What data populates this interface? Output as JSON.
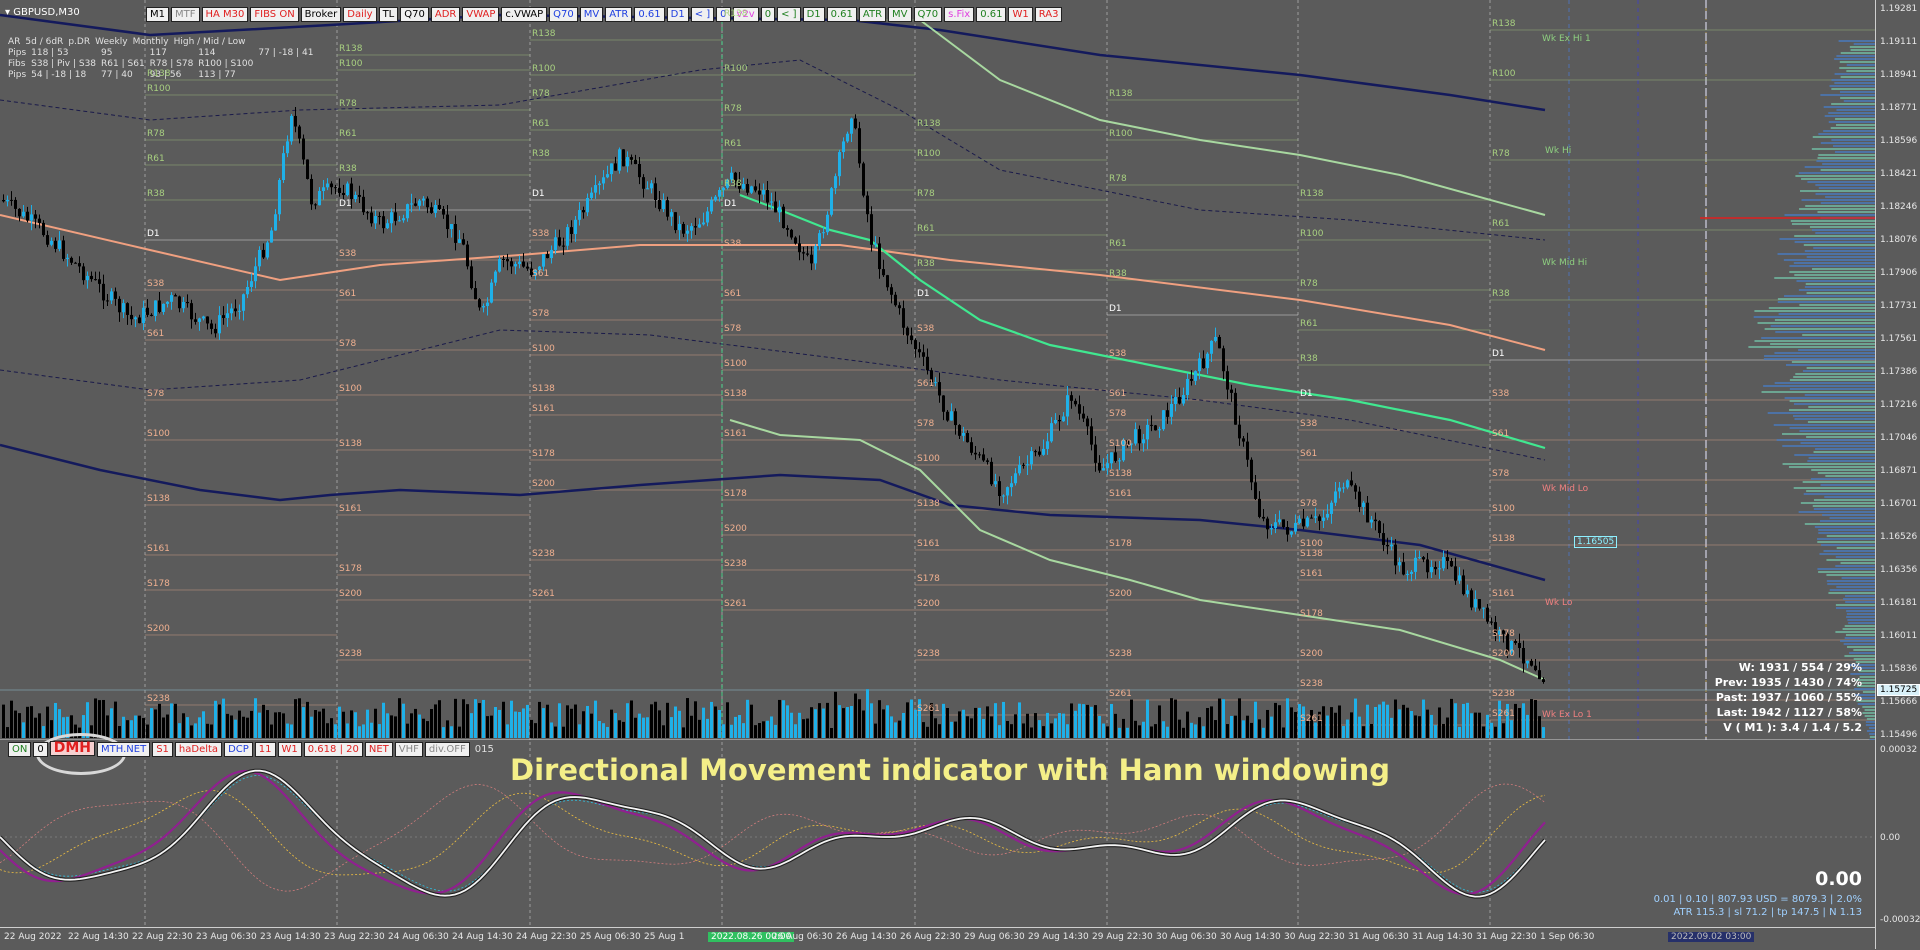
{
  "symbol": "GBPUSD,M30",
  "toolbar_top": [
    {
      "label": "M1",
      "color": "#000000",
      "bg": "#f0f0f0"
    },
    {
      "label": "MTF",
      "color": "#888888",
      "bg": "#f0f0f0"
    },
    {
      "label": "HA M30",
      "color": "#e02020",
      "bg": "#f0f0f0"
    },
    {
      "label": "FIBS ON",
      "color": "#e02020",
      "bg": "#f0f0f0"
    },
    {
      "label": "Broker",
      "color": "#000000",
      "bg": "#f0f0f0"
    },
    {
      "label": "Daily",
      "color": "#e02020",
      "bg": "#f0f0f0"
    },
    {
      "label": "TL",
      "color": "#000000",
      "bg": "#f0f0f0"
    },
    {
      "label": "Q70",
      "color": "#000000",
      "bg": "#f0f0f0"
    },
    {
      "label": "ADR",
      "color": "#e02020",
      "bg": "#f0f0f0"
    },
    {
      "label": "VWAP",
      "color": "#e02020",
      "bg": "#f0f0f0"
    },
    {
      "label": "c.VWAP",
      "color": "#000000",
      "bg": "#f0f0f0"
    },
    {
      "label": "Q70",
      "color": "#2040e0",
      "bg": "#f0f0f0"
    },
    {
      "label": "MV",
      "color": "#2040e0",
      "bg": "#f0f0f0"
    },
    {
      "label": "ATR",
      "color": "#2040e0",
      "bg": "#f0f0f0"
    },
    {
      "label": "0.61",
      "color": "#2040e0",
      "bg": "#f0f0f0"
    },
    {
      "label": "D1",
      "color": "#2040e0",
      "bg": "#f0f0f0"
    },
    {
      "label": "< ]",
      "color": "#2040e0",
      "bg": "#f0f0f0"
    },
    {
      "label": "0",
      "color": "#2040e0",
      "bg": "#f0f0f0"
    },
    {
      "label": "v2v",
      "color": "#e040e0",
      "bg": "#f0f0f0"
    },
    {
      "label": "0",
      "color": "#208020",
      "bg": "#f0f0f0"
    },
    {
      "label": "< ]",
      "color": "#208020",
      "bg": "#f0f0f0"
    },
    {
      "label": "D1",
      "color": "#208020",
      "bg": "#f0f0f0"
    },
    {
      "label": "0.61",
      "color": "#208020",
      "bg": "#f0f0f0"
    },
    {
      "label": "ATR",
      "color": "#208020",
      "bg": "#f0f0f0"
    },
    {
      "label": "MV",
      "color": "#208020",
      "bg": "#f0f0f0"
    },
    {
      "label": "Q70",
      "color": "#208020",
      "bg": "#f0f0f0"
    },
    {
      "label": "s.Fix",
      "color": "#e040e0",
      "bg": "#f0f0f0"
    },
    {
      "label": "0.61",
      "color": "#208020",
      "bg": "#f0f0f0"
    },
    {
      "label": "W1",
      "color": "#e02020",
      "bg": "#f0f0f0"
    },
    {
      "label": "RA3",
      "color": "#e02020",
      "bg": "#f0f0f0"
    }
  ],
  "stats": {
    "headers": [
      "AR",
      "5d / 6dR",
      "p.DR",
      "Weekly",
      "Monthly",
      "High / Mid / Low"
    ],
    "rows": [
      [
        "Pips",
        "118 | 53",
        "95",
        "117",
        "114",
        "77 | -18 | 41"
      ],
      [
        "Fibs",
        "S38 | Piv | S38",
        "R61 | S61",
        "R78 | S78",
        "R100 | S100",
        ""
      ],
      [
        "Pips",
        "54 | -18 | 18",
        "77 | 40",
        "93 | 56",
        "113 | 77",
        ""
      ]
    ]
  },
  "toolbar_ind": [
    {
      "label": "ON",
      "color": "#208020"
    },
    {
      "label": "0",
      "color": "#000000"
    },
    {
      "label": "DMH",
      "color": "#e02020"
    },
    {
      "label": "MTH.NET",
      "color": "#2040e0"
    },
    {
      "label": "S1",
      "color": "#e02020"
    },
    {
      "label": "haDelta",
      "color": "#e02020"
    },
    {
      "label": "DCP",
      "color": "#2040e0"
    },
    {
      "label": "11",
      "color": "#e02020"
    },
    {
      "label": "W1",
      "color": "#e02020"
    },
    {
      "label": "0.618 | 20",
      "color": "#e02020"
    },
    {
      "label": "NET",
      "color": "#e02020"
    },
    {
      "label": "VHF",
      "color": "#888888"
    },
    {
      "label": "div.OFF",
      "color": "#888888"
    },
    {
      "label": "015",
      "color": "#e0e0e0"
    }
  ],
  "indicator_title": "Directional Movement indicator with Hann windowing",
  "indicator_value": "0.00",
  "info_box": [
    "W: 1931 / 554 / 29%",
    "Prev: 1935 / 1430 / 74%",
    "Past: 1937 / 1060 / 55%",
    "Last: 1942 / 1127 / 58%",
    "V ( M1 ): 3.4 / 1.4 / 5.2"
  ],
  "bottom_info": [
    "0.01  |  0.10  |  807.93 USD = 8079.3  |  2.0%",
    "ATR 115.3  |  sl 71.2  |  tp 147.5  |  N 1.13"
  ],
  "price_axis": [
    "1.19281",
    "1.19111",
    "1.18941",
    "1.18771",
    "1.18596",
    "1.18421",
    "1.18246",
    "1.18076",
    "1.17906",
    "1.17731",
    "1.17561",
    "1.17386",
    "1.17216",
    "1.17046",
    "1.16871",
    "1.16701",
    "1.16526",
    "1.16356",
    "1.16181",
    "1.16011",
    "1.15836",
    "1.15666",
    "1.15496"
  ],
  "current_price": "1.15725",
  "price_marker": "1.16505",
  "indicator_axis": [
    "0.00032",
    "0.00",
    "-0.00032"
  ],
  "time_axis": [
    "22 Aug 2022",
    "22 Aug 14:30",
    "22 Aug 22:30",
    "23 Aug 06:30",
    "23 Aug 14:30",
    "23 Aug 22:30",
    "24 Aug 06:30",
    "24 Aug 14:30",
    "24 Aug 22:30",
    "25 Aug 06:30",
    "25 Aug 1",
    "2022.08.26 00:00",
    "26 Aug 06:30",
    "26 Aug 14:30",
    "26 Aug 22:30",
    "29 Aug 06:30",
    "29 Aug 14:30",
    "29 Aug 22:30",
    "30 Aug 06:30",
    "30 Aug 14:30",
    "30 Aug 22:30",
    "31 Aug 06:30",
    "31 Aug 14:30",
    "31 Aug 22:30",
    "1 Sep 06:30"
  ],
  "time_highlight": "2022.08.26 00:00",
  "time_right": "2022.09.02 03:00",
  "weekly_levels": [
    "Wk Ex Hi 1",
    "Wk Hi",
    "Wk Mid Hi",
    "Wk Mid Lo",
    "Wk Lo",
    "Wk Ex Lo 1"
  ],
  "fib_labels": [
    "R138",
    "R100",
    "R78",
    "R61",
    "R38",
    "D1",
    "S38",
    "S61",
    "S78",
    "S100",
    "S138",
    "S161",
    "S178",
    "S200",
    "S238",
    "S261"
  ],
  "colors": {
    "bg": "#5b5b5b",
    "candle_up": "#1fb0e8",
    "candle_down": "#000000",
    "ma_navy": "#141a5c",
    "ma_salmon": "#f0a080",
    "ma_green": "#40e890",
    "ma_sage": "#a8d8a0",
    "title_yellow": "#f4ef88"
  }
}
